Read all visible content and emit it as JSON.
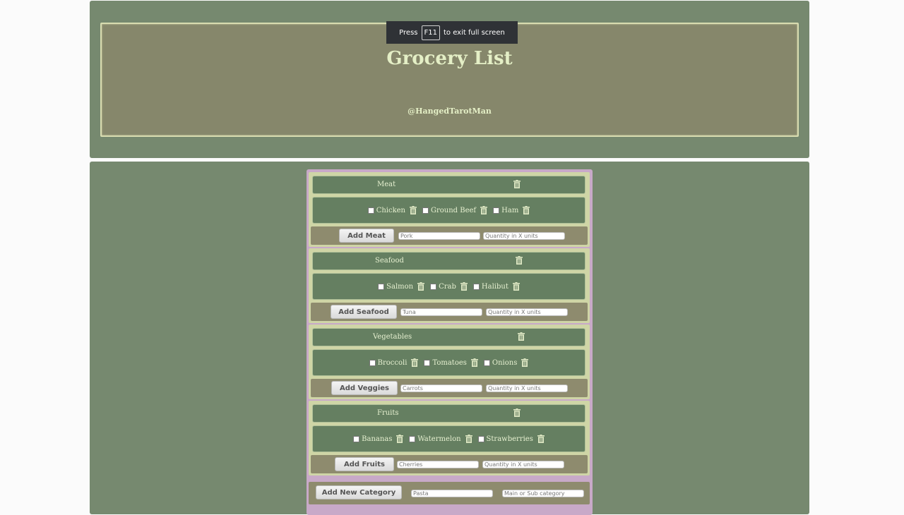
{
  "header": {
    "title": "Grocery List",
    "handle": "@HangedTarotMan",
    "fullscreen_press": "Press",
    "fullscreen_key": "F11",
    "fullscreen_rest": "to exit full screen"
  },
  "categories": [
    {
      "name": "Meat",
      "items": [
        "Chicken",
        "Ground Beef",
        "Ham"
      ],
      "button": "Add Meat",
      "item_placeholder": "Pork",
      "qty_placeholder": "Quantity in X units"
    },
    {
      "name": "Seafood",
      "items": [
        "Salmon",
        "Crab",
        "Halibut"
      ],
      "button": "Add Seafood",
      "item_placeholder": "Tuna",
      "qty_placeholder": "Quantity in X units"
    },
    {
      "name": "Vegetables",
      "items": [
        "Broccoli",
        "Tomatoes",
        "Onions"
      ],
      "button": "Add Veggies",
      "item_placeholder": "Carrots",
      "qty_placeholder": "Quantity in X units"
    },
    {
      "name": "Fruits",
      "items": [
        "Bananas",
        "Watermelon",
        "Strawberries"
      ],
      "button": "Add Fruits",
      "item_placeholder": "Cherries",
      "qty_placeholder": "Quantity in X units"
    }
  ],
  "new_category": {
    "button": "Add New Category",
    "name_placeholder": "Pasta",
    "type_placeholder": "Main or Sub category"
  },
  "icons": {
    "delete": "trash-icon"
  },
  "colors": {
    "panel": "#76896f",
    "header_inner": "#86876b",
    "title": "#e4efc6",
    "category_bar": "#657f61",
    "list_border": "#c8a9c8"
  }
}
